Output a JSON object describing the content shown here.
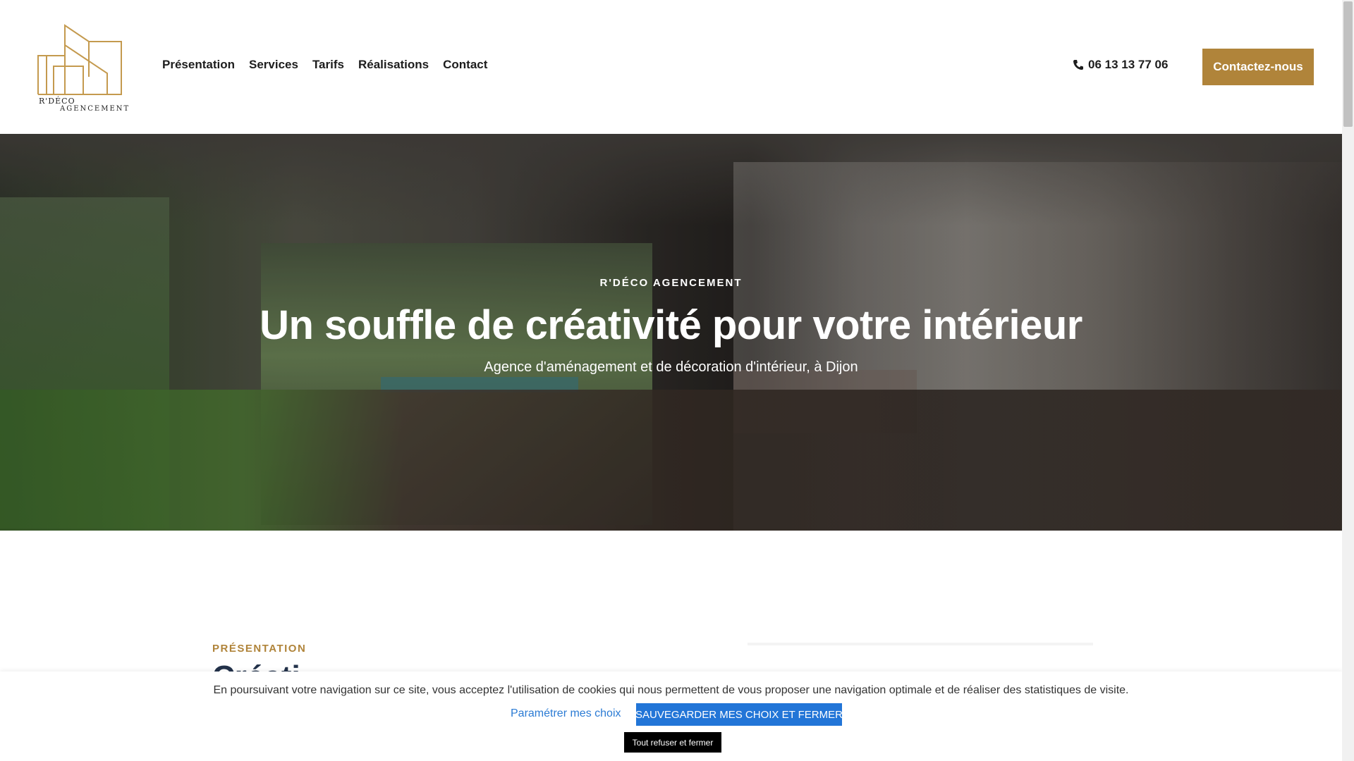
{
  "header": {
    "logo": {
      "line1": "R'DÉCO",
      "line2": "AGENCEMENT"
    },
    "nav": [
      {
        "label": "Présentation"
      },
      {
        "label": "Services"
      },
      {
        "label": "Tarifs"
      },
      {
        "label": "Réalisations"
      },
      {
        "label": "Contact"
      }
    ],
    "phone": "06 13 13 77 06",
    "phone_icon": "phone-icon",
    "cta_label": "Contactez-nous"
  },
  "hero": {
    "eyebrow": "R'DÉCO AGENCEMENT",
    "title": "Un souffle de créativité pour votre intérieur",
    "subtitle": "Agence d'aménagement et de décoration d'intérieur, à Dijon"
  },
  "presentation": {
    "label": "PRÉSENTATION",
    "heading_partial": "Créati..."
  },
  "cookie_banner": {
    "message": "En poursuivant votre navigation sur ce site, vous acceptez l'utilisation de cookies qui nous permettent de vous proposer une navigation optimale et de réaliser des statistiques de visite.",
    "settings_link": "Paramétrer mes choix",
    "save_button": "SAUVEGARDER MES CHOIX ET FERMER",
    "refuse_button": "Tout refuser et fermer"
  },
  "colors": {
    "accent": "#b0843a",
    "cookie_save": "#2275d7",
    "heading": "#23324a"
  }
}
